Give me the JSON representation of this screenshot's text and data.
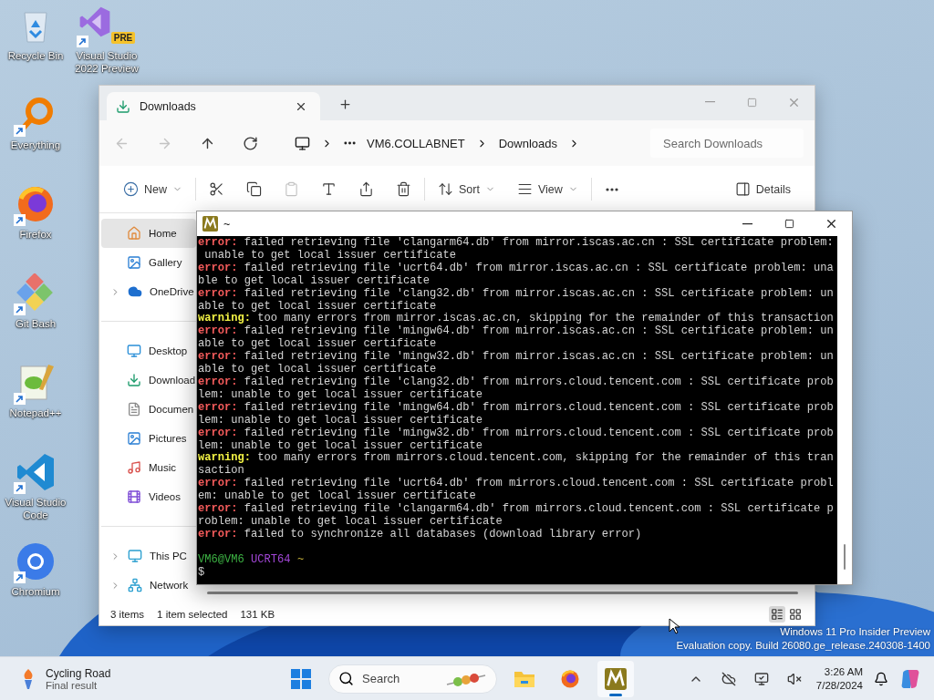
{
  "desktop_icons": [
    {
      "label": "Recycle Bin",
      "kind": "recycle",
      "shortcut": false
    },
    {
      "label": "Everything",
      "kind": "everything",
      "shortcut": true
    },
    {
      "label": "Firefox",
      "kind": "firefox",
      "shortcut": true
    },
    {
      "label": "Git Bash",
      "kind": "gitbash",
      "shortcut": true
    },
    {
      "label": "Notepad++",
      "kind": "notepad",
      "shortcut": true
    },
    {
      "label": "Visual Studio Code",
      "kind": "vscode",
      "shortcut": true
    },
    {
      "label": "Chromium",
      "kind": "chromium",
      "shortcut": true
    },
    {
      "label": "Visual Studio 2022 Preview",
      "kind": "vs",
      "shortcut": true,
      "badge": "PRE"
    }
  ],
  "explorer": {
    "tab": {
      "title": "Downloads"
    },
    "nav": [
      {
        "kind": "back",
        "disabled": true
      },
      {
        "kind": "forward",
        "disabled": true
      },
      {
        "kind": "up",
        "disabled": false
      },
      {
        "kind": "refresh",
        "disabled": false
      }
    ],
    "path": [
      "VM6.COLLABNET",
      "Downloads"
    ],
    "search": {
      "placeholder": "Search Downloads"
    },
    "toolbar_groups": [
      {
        "items": [
          {
            "kind": "new",
            "label": "New",
            "dropdown": true,
            "disabled": false
          }
        ]
      },
      {
        "items": [
          {
            "kind": "cut",
            "disabled": false
          },
          {
            "kind": "copy",
            "disabled": false
          },
          {
            "kind": "paste",
            "disabled": true
          },
          {
            "kind": "rename",
            "disabled": false
          },
          {
            "kind": "share",
            "disabled": false
          },
          {
            "kind": "delete",
            "disabled": false
          }
        ]
      },
      {
        "items": [
          {
            "kind": "sort",
            "label": "Sort",
            "dropdown": true,
            "disabled": false
          },
          {
            "kind": "view",
            "label": "View",
            "dropdown": true,
            "disabled": false
          }
        ]
      },
      {
        "items": [
          {
            "kind": "more",
            "disabled": false
          }
        ]
      },
      {
        "items": [
          {
            "kind": "details",
            "label": "Details",
            "disabled": false
          }
        ]
      }
    ],
    "sidebar": [
      {
        "items": [
          {
            "label": "Home",
            "kind": "home",
            "selected": true,
            "expandable": false
          },
          {
            "label": "Gallery",
            "kind": "gallery",
            "selected": false,
            "expandable": false
          },
          {
            "label": "OneDrive",
            "kind": "onedrive",
            "selected": false,
            "expandable": true
          }
        ]
      },
      {
        "items": [
          {
            "label": "Desktop",
            "kind": "desktop",
            "selected": false,
            "expandable": false
          },
          {
            "label": "Download",
            "kind": "downloads",
            "selected": false,
            "expandable": false
          },
          {
            "label": "Documen",
            "kind": "documents",
            "selected": false,
            "expandable": false
          },
          {
            "label": "Pictures",
            "kind": "pictures",
            "selected": false,
            "expandable": false
          },
          {
            "label": "Music",
            "kind": "music",
            "selected": false,
            "expandable": false
          },
          {
            "label": "Videos",
            "kind": "videos",
            "selected": false,
            "expandable": false
          }
        ]
      },
      {
        "items": [
          {
            "label": "This PC",
            "kind": "thispc",
            "selected": false,
            "expandable": true
          },
          {
            "label": "Network",
            "kind": "network",
            "selected": false,
            "expandable": true
          }
        ]
      }
    ],
    "status": {
      "count": "3 items",
      "selection": "1 item selected",
      "size": "131 KB"
    },
    "view_modes": [
      {
        "kind": "details",
        "selected": true
      },
      {
        "kind": "tiles",
        "selected": false
      }
    ]
  },
  "terminal": {
    "title": "~",
    "lines": [
      {
        "kind": "error",
        "label": "error:",
        "text": "failed retrieving file 'clangarm64.db' from mirror.iscas.ac.cn : SSL certificate problem: unable to get local issuer certificate"
      },
      {
        "kind": "error",
        "label": "error:",
        "text": "failed retrieving file 'ucrt64.db' from mirror.iscas.ac.cn : SSL certificate problem: unable to get local issuer certificate"
      },
      {
        "kind": "error",
        "label": "error:",
        "text": "failed retrieving file 'clang32.db' from mirror.iscas.ac.cn : SSL certificate problem: unable to get local issuer certificate"
      },
      {
        "kind": "warning",
        "label": "warning:",
        "text": "too many errors from mirror.iscas.ac.cn, skipping for the remainder of this transaction"
      },
      {
        "kind": "error",
        "label": "error:",
        "text": "failed retrieving file 'mingw64.db' from mirror.iscas.ac.cn : SSL certificate problem: unable to get local issuer certificate"
      },
      {
        "kind": "error",
        "label": "error:",
        "text": "failed retrieving file 'mingw32.db' from mirror.iscas.ac.cn : SSL certificate problem: unable to get local issuer certificate"
      },
      {
        "kind": "error",
        "label": "error:",
        "text": "failed retrieving file 'clang32.db' from mirrors.cloud.tencent.com : SSL certificate problem: unable to get local issuer certificate"
      },
      {
        "kind": "error",
        "label": "error:",
        "text": "failed retrieving file 'mingw64.db' from mirrors.cloud.tencent.com : SSL certificate problem: unable to get local issuer certificate"
      },
      {
        "kind": "error",
        "label": "error:",
        "text": "failed retrieving file 'mingw32.db' from mirrors.cloud.tencent.com : SSL certificate problem: unable to get local issuer certificate"
      },
      {
        "kind": "warning",
        "label": "warning:",
        "text": "too many errors from mirrors.cloud.tencent.com, skipping for the remainder of this transaction"
      },
      {
        "kind": "error",
        "label": "error:",
        "text": "failed retrieving file 'ucrt64.db' from mirrors.cloud.tencent.com : SSL certificate problem: unable to get local issuer certificate"
      },
      {
        "kind": "error",
        "label": "error:",
        "text": "failed retrieving file 'clangarm64.db' from mirrors.cloud.tencent.com : SSL certificate problem: unable to get local issuer certificate"
      },
      {
        "kind": "error",
        "label": "error:",
        "text": "failed to synchronize all databases (download library error)"
      }
    ],
    "prompt": {
      "user": "VM6@VM6",
      "env": "UCRT64",
      "path": "~",
      "symbol": "$"
    }
  },
  "os_notice": {
    "edition": "Windows 11 Pro Insider Preview",
    "build": "Evaluation copy. Build 26080.ge_release.240308-1400"
  },
  "taskbar": {
    "widget": {
      "title": "Cycling Road",
      "subtitle": "Final result"
    },
    "search": {
      "placeholder": "Search"
    },
    "apps": [
      {
        "kind": "explorer",
        "active": false
      },
      {
        "kind": "firefox",
        "active": false
      },
      {
        "kind": "msys2",
        "active": true
      }
    ],
    "tray": [
      {
        "kind": "chevron"
      },
      {
        "kind": "cloud"
      },
      {
        "kind": "monitor"
      },
      {
        "kind": "volume"
      }
    ],
    "clock": {
      "time": "3:26 AM",
      "date": "7/28/2024"
    }
  }
}
